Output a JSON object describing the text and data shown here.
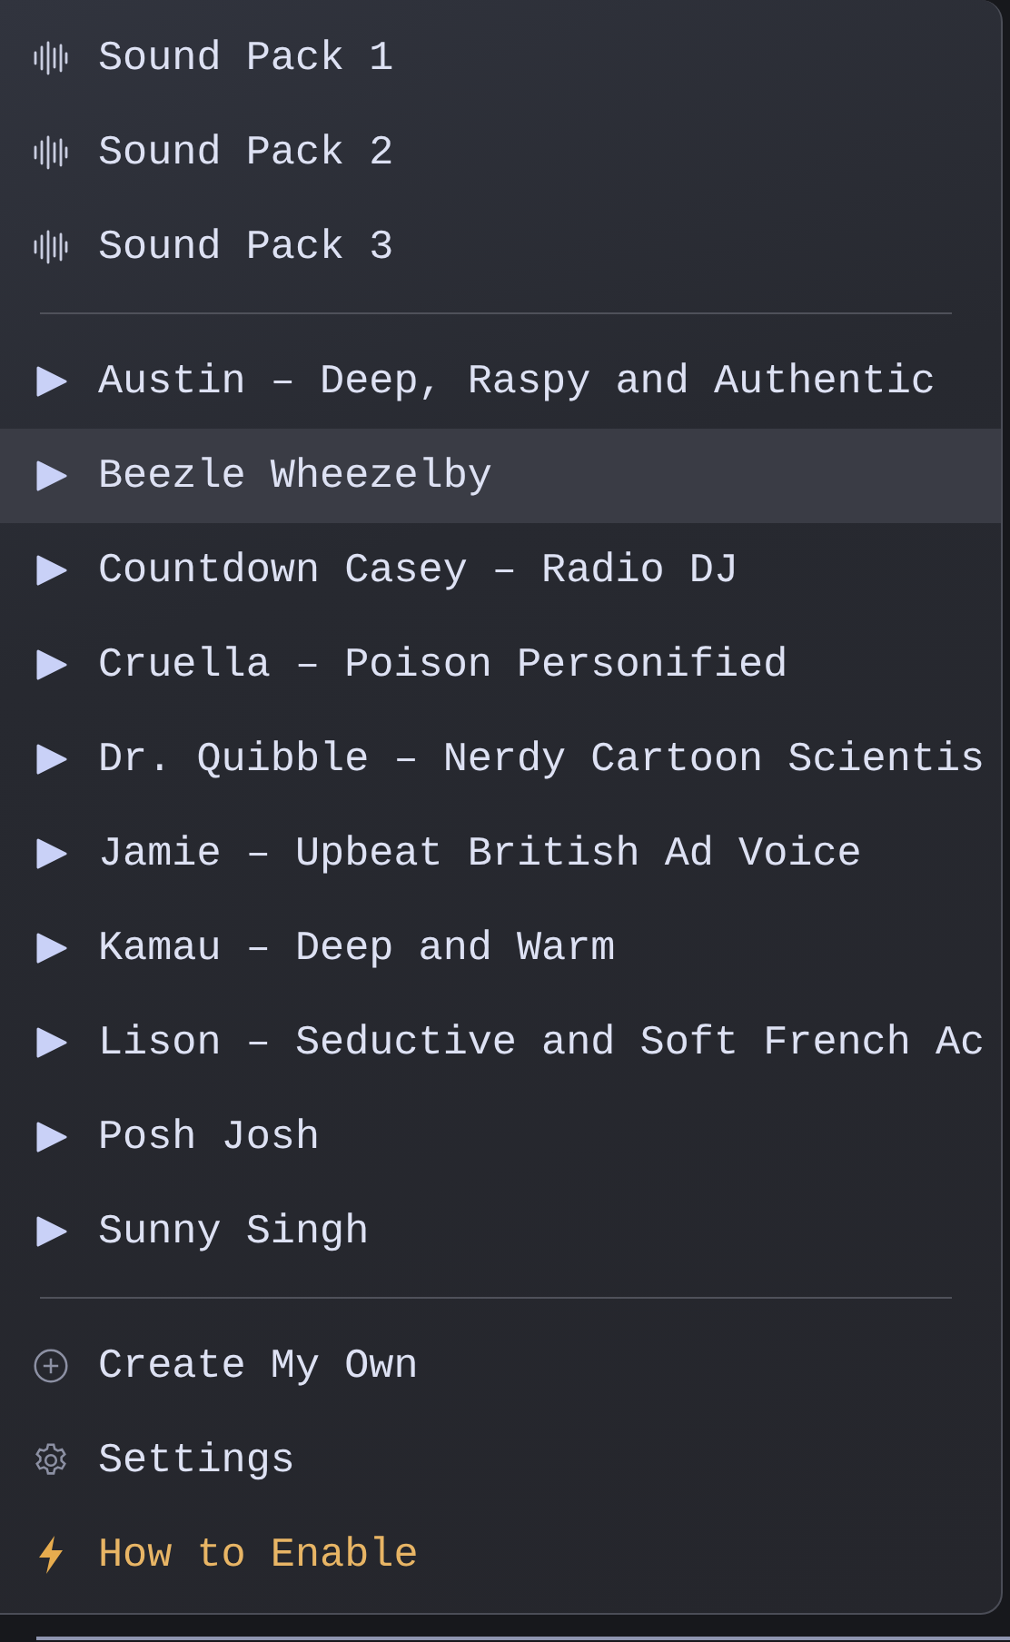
{
  "sound_packs": [
    {
      "label": "Sound Pack 1"
    },
    {
      "label": "Sound Pack 2"
    },
    {
      "label": "Sound Pack 3"
    }
  ],
  "voices": [
    {
      "label": "Austin – Deep, Raspy and Authentic",
      "selected": false
    },
    {
      "label": "Beezle Wheezelby",
      "selected": true
    },
    {
      "label": "Countdown Casey – Radio DJ",
      "selected": false
    },
    {
      "label": "Cruella – Poison Personified",
      "selected": false
    },
    {
      "label": "Dr. Quibble – Nerdy Cartoon Scientis",
      "selected": false
    },
    {
      "label": "Jamie – Upbeat British Ad Voice",
      "selected": false
    },
    {
      "label": "Kamau – Deep and Warm",
      "selected": false
    },
    {
      "label": "Lison – Seductive and Soft French Ac",
      "selected": false
    },
    {
      "label": "Posh Josh",
      "selected": false
    },
    {
      "label": "Sunny Singh",
      "selected": false
    }
  ],
  "actions": [
    {
      "kind": "create",
      "label": "Create My Own"
    },
    {
      "kind": "settings",
      "label": "Settings"
    },
    {
      "kind": "enable",
      "label": "How to Enable"
    }
  ]
}
